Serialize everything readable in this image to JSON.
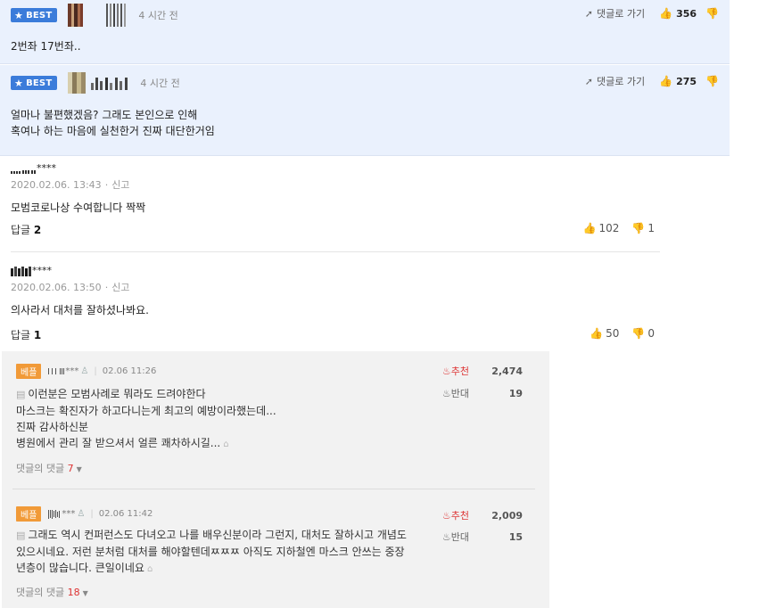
{
  "best_comments": [
    {
      "badge": "BEST",
      "time": "4 시간 전",
      "goto_label": "댓글로 가기",
      "likes": "356",
      "lines": [
        "2번좌 17번좌.."
      ]
    },
    {
      "badge": "BEST",
      "time": "4 시간 전",
      "goto_label": "댓글로 가기",
      "likes": "275",
      "lines": [
        "얼마나 불편했겠음? 그래도 본인으로 인해",
        "혹여나 하는 마음에 실천한거 진짜 대단한거임"
      ]
    }
  ],
  "comments": [
    {
      "nick_suffix": "****",
      "date": "2020.02.06. 13:43",
      "report": "신고",
      "text": "모범코로나상 수여합니다 짝짝",
      "reply_label": "답글",
      "reply_count": "2",
      "up": "102",
      "down": "1"
    },
    {
      "nick_suffix": "****",
      "date": "2020.02.06. 13:50",
      "report": "신고",
      "text": "의사라서 대처를 잘하셨나봐요.",
      "reply_label": "답글",
      "reply_count": "1",
      "up": "50",
      "down": "0"
    }
  ],
  "gray_comments": [
    {
      "tag": "베플",
      "nick_suffix": "***",
      "date": "02.06 11:26",
      "recommend_label": "추천",
      "recommend_count": "2,474",
      "oppose_label": "반대",
      "oppose_count": "19",
      "lines": [
        "이런분은 모범사례로 뭐라도 드려야한다",
        "마스크는 확진자가 하고다니는게 최고의 예방이라했는데...",
        "진짜 감사하신분",
        "병원에서 관리 잘 받으셔서 얼른 쾌차하시길..."
      ],
      "replies_label": "댓글의 댓글",
      "replies_count": "7"
    },
    {
      "tag": "베플",
      "nick_suffix": "***",
      "date": "02.06 11:42",
      "recommend_label": "추천",
      "recommend_count": "2,009",
      "oppose_label": "반대",
      "oppose_count": "15",
      "lines": [
        "그래도 역시 컨퍼런스도 다녀오고 나를 배우신분이라 그런지, 대처도 잘하시고 개념도",
        "있으시네요. 저런 분처럼 대처를 해야할텐데ㅉㅉㅉ 아직도 지하철엔 마스크 안쓰는 중장",
        "년층이 많습니다. 큰일이네요"
      ],
      "replies_label": "댓글의 댓글",
      "replies_count": "18"
    }
  ],
  "colors": {
    "best_bg": "#eaf1fd",
    "best_badge": "#3b7cda",
    "tag_orange": "#f19a38",
    "recommend_red": "#dd3333"
  }
}
